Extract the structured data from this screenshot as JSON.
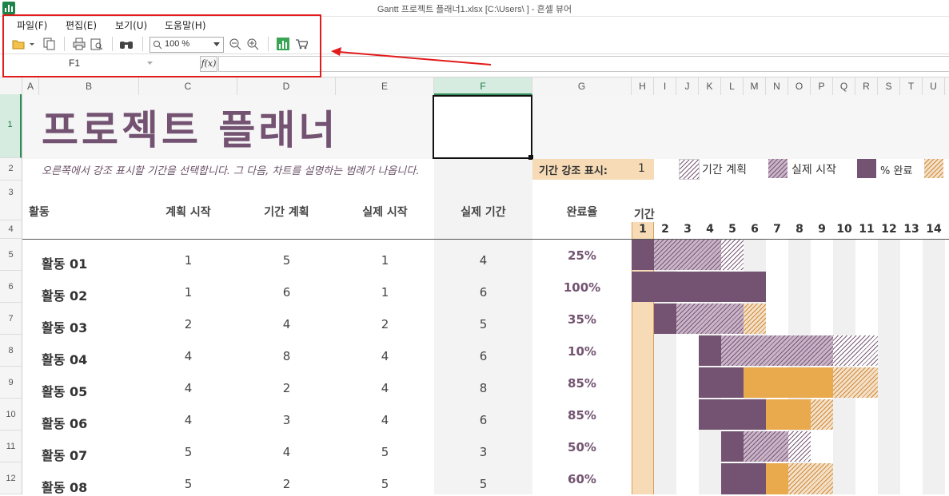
{
  "window": {
    "title": "Gantt 프로젝트 플래너1.xlsx [C:\\Users\\                           ] - 흔셀 뷰어"
  },
  "menu": {
    "file": "파일(F)",
    "edit": "편집(E)",
    "view": "보기(U)",
    "help": "도움말(H)"
  },
  "toolbar": {
    "zoom": "100 %",
    "icons": [
      "open-folder-icon",
      "copy-icon",
      "print-icon",
      "print-preview-icon",
      "find-icon",
      "zoom-out-icon",
      "zoom-in-icon",
      "chart-icon",
      "cart-icon"
    ]
  },
  "formula_bar": {
    "cell_ref": "F1",
    "fx": "f(x)",
    "value": ""
  },
  "columns": [
    "A",
    "B",
    "C",
    "D",
    "E",
    "F",
    "G",
    "H",
    "I",
    "J",
    "K",
    "L",
    "M",
    "N",
    "O",
    "P",
    "Q",
    "R",
    "S",
    "T",
    "U"
  ],
  "selected_column": "F",
  "rows": [
    "1",
    "2",
    "3",
    "4",
    "5",
    "6",
    "7",
    "8",
    "9",
    "10",
    "11",
    "12"
  ],
  "sheet": {
    "title": "프로젝트 플래너",
    "subtitle": "오른쪽에서 강조 표시할 기간을 선택합니다. 그 다음, 차트를 설명하는 범례가 나옵니다.",
    "period_label": "기간 강조 표시:",
    "period_value": "1",
    "legend": {
      "plan": "기간 계획",
      "actual": "실제 시작",
      "pct": "% 완료"
    },
    "headers": {
      "activity": "활동",
      "plan_start": "계획 시작",
      "plan_dur": "기간 계획",
      "act_start": "실제 시작",
      "act_dur": "실제 기간",
      "pct": "완료율",
      "period": "기간"
    },
    "periods": [
      "1",
      "2",
      "3",
      "4",
      "5",
      "6",
      "7",
      "8",
      "9",
      "10",
      "11",
      "12",
      "13",
      "14"
    ],
    "activities": [
      {
        "name": "활동 01",
        "plan_start": "1",
        "plan_dur": "5",
        "act_start": "1",
        "act_dur": "4",
        "pct": "25%"
      },
      {
        "name": "활동 02",
        "plan_start": "1",
        "plan_dur": "6",
        "act_start": "1",
        "act_dur": "6",
        "pct": "100%"
      },
      {
        "name": "활동 03",
        "plan_start": "2",
        "plan_dur": "4",
        "act_start": "2",
        "act_dur": "5",
        "pct": "35%"
      },
      {
        "name": "활동 04",
        "plan_start": "4",
        "plan_dur": "8",
        "act_start": "4",
        "act_dur": "6",
        "pct": "10%"
      },
      {
        "name": "활동 05",
        "plan_start": "4",
        "plan_dur": "2",
        "act_start": "4",
        "act_dur": "8",
        "pct": "85%"
      },
      {
        "name": "활동 06",
        "plan_start": "4",
        "plan_dur": "3",
        "act_start": "4",
        "act_dur": "6",
        "pct": "85%"
      },
      {
        "name": "활동 07",
        "plan_start": "5",
        "plan_dur": "4",
        "act_start": "5",
        "act_dur": "3",
        "pct": "50%"
      },
      {
        "name": "활동 08",
        "plan_start": "5",
        "plan_dur": "2",
        "act_start": "5",
        "act_dur": "5",
        "pct": "60%"
      }
    ]
  },
  "colors": {
    "title": "#735371",
    "highlight": "#f6dbb6",
    "accent_orange": "#e9aa4d",
    "annotation_red": "#e21b1b"
  }
}
